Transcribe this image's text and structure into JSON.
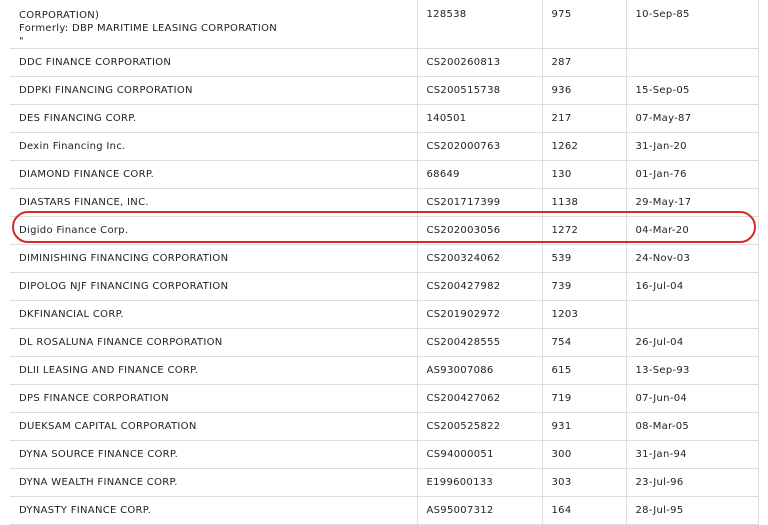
{
  "rows": [
    {
      "name_lines": [
        "CORPORATION)",
        "Formerly: DBP MARITIME LEASING CORPORATION",
        "\""
      ],
      "reg": "128538",
      "num": "975",
      "date": "10-Sep-85"
    },
    {
      "name": "DDC FINANCE CORPORATION",
      "reg": "CS200260813",
      "num": "287",
      "date": ""
    },
    {
      "name": "DDPKI FINANCING CORPORATION",
      "reg": "CS200515738",
      "num": "936",
      "date": "15-Sep-05"
    },
    {
      "name": "DES FINANCING CORP.",
      "reg": "140501",
      "num": "217",
      "date": "07-May-87"
    },
    {
      "name": "Dexin Financing Inc.",
      "reg": "CS202000763",
      "num": "1262",
      "date": "31-Jan-20"
    },
    {
      "name": "DIAMOND FINANCE CORP.",
      "reg": "68649",
      "num": "130",
      "date": "01-Jan-76"
    },
    {
      "name": "DIASTARS FINANCE, INC.",
      "reg": "CS201717399",
      "num": "1138",
      "date": "29-May-17"
    },
    {
      "name": "Digido Finance Corp.",
      "reg": "CS202003056",
      "num": "1272",
      "date": "04-Mar-20"
    },
    {
      "name": "DIMINISHING FINANCING CORPORATION",
      "reg": "CS200324062",
      "num": "539",
      "date": "24-Nov-03"
    },
    {
      "name": "DIPOLOG NJF FINANCING CORPORATION",
      "reg": "CS200427982",
      "num": "739",
      "date": "16-Jul-04"
    },
    {
      "name": "DKFINANCIAL CORP.",
      "reg": "CS201902972",
      "num": "1203",
      "date": ""
    },
    {
      "name": "DL ROSALUNA FINANCE CORPORATION",
      "reg": "CS200428555",
      "num": "754",
      "date": "26-Jul-04"
    },
    {
      "name": "DLII LEASING AND FINANCE CORP.",
      "reg": "AS93007086",
      "num": "615",
      "date": "13-Sep-93"
    },
    {
      "name": "DPS FINANCE CORPORATION",
      "reg": "CS200427062",
      "num": "719",
      "date": "07-Jun-04"
    },
    {
      "name": "DUEKSAM CAPITAL CORPORATION",
      "reg": "CS200525822",
      "num": "931",
      "date": "08-Mar-05"
    },
    {
      "name": "DYNA SOURCE FINANCE CORP.",
      "reg": "CS94000051",
      "num": "300",
      "date": "31-Jan-94"
    },
    {
      "name": "DYNA WEALTH FINANCE CORP.",
      "reg": "E199600133",
      "num": "303",
      "date": "23-Jul-96"
    },
    {
      "name": "DYNASTY FINANCE CORP.",
      "reg": "AS95007312",
      "num": "164",
      "date": "28-Jul-95"
    }
  ],
  "highlight": {
    "row_index": 7,
    "color": "#d42a2a"
  }
}
